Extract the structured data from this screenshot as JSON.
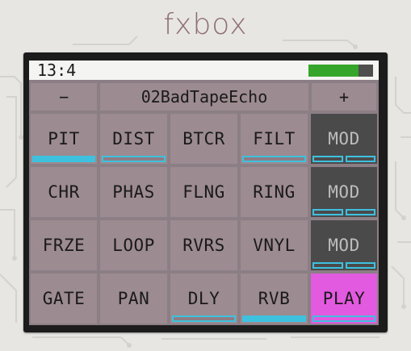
{
  "device": {
    "brand": "fxbox"
  },
  "status": {
    "time": "13:4",
    "battery_level": 0.78,
    "battery_color": "#35a52c"
  },
  "preset": {
    "prev_label": "−",
    "name": "02BadTapeEcho",
    "next_label": "+"
  },
  "grid": {
    "rows": [
      [
        {
          "label": "PIT",
          "indicator": "on"
        },
        {
          "label": "DIST",
          "indicator": "outline"
        },
        {
          "label": "BTCR",
          "indicator": "none"
        },
        {
          "label": "FILT",
          "indicator": "outline"
        },
        {
          "label": "MOD",
          "indicator": "split",
          "type": "mod"
        }
      ],
      [
        {
          "label": "CHR",
          "indicator": "none"
        },
        {
          "label": "PHAS",
          "indicator": "none"
        },
        {
          "label": "FLNG",
          "indicator": "none"
        },
        {
          "label": "RING",
          "indicator": "none"
        },
        {
          "label": "MOD",
          "indicator": "split",
          "type": "mod"
        }
      ],
      [
        {
          "label": "FRZE",
          "indicator": "none"
        },
        {
          "label": "LOOP",
          "indicator": "none"
        },
        {
          "label": "RVRS",
          "indicator": "none"
        },
        {
          "label": "VNYL",
          "indicator": "none"
        },
        {
          "label": "MOD",
          "indicator": "split",
          "type": "mod"
        }
      ],
      [
        {
          "label": "GATE",
          "indicator": "none"
        },
        {
          "label": "PAN",
          "indicator": "none"
        },
        {
          "label": "DLY",
          "indicator": "outline"
        },
        {
          "label": "RVB",
          "indicator": "on"
        },
        {
          "label": "PLAY",
          "indicator": "play",
          "type": "play"
        }
      ]
    ]
  },
  "colors": {
    "accent": "#3ec1df",
    "cell": "#9c8b90",
    "mod_cell": "#4b4a4b",
    "play_cell": "#e25ae0",
    "brand_text": "#8f6f77"
  }
}
